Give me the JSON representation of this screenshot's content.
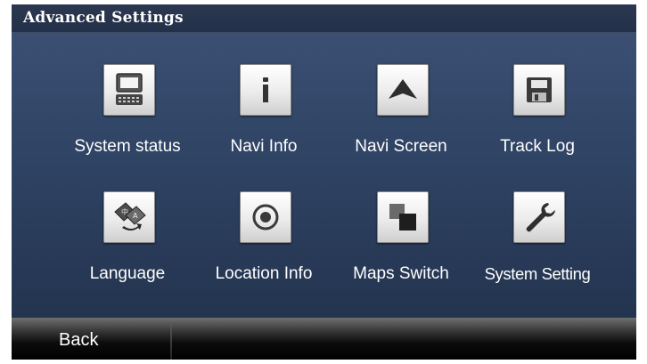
{
  "title": "Advanced Settings",
  "tiles": [
    {
      "label": "System status",
      "icon": "system-status-icon"
    },
    {
      "label": "Navi Info",
      "icon": "info-icon"
    },
    {
      "label": "Navi Screen",
      "icon": "navi-screen-arrow-icon"
    },
    {
      "label": "Track Log",
      "icon": "floppy-disk-icon"
    },
    {
      "label": "Language",
      "icon": "language-icon"
    },
    {
      "label": "Location Info",
      "icon": "location-target-icon"
    },
    {
      "label": "Maps Switch",
      "icon": "maps-switch-icon"
    },
    {
      "label": "System Setting",
      "icon": "wrench-icon"
    }
  ],
  "footer": {
    "back_label": "Back"
  }
}
